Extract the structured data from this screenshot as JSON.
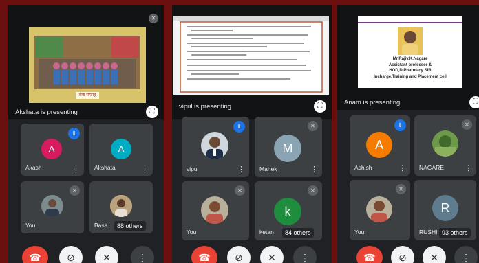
{
  "panels": [
    {
      "presenter_label": "Akshata is presenting",
      "others_label": "88 others",
      "tiles": [
        {
          "name": "Akash",
          "initial": "A",
          "color": "#d81b60"
        },
        {
          "name": "Akshata",
          "initial": "A",
          "color": "#00acc1"
        },
        {
          "name": "You"
        },
        {
          "name": "Basa"
        }
      ],
      "slide_caption": "सेवा सप्ताह"
    },
    {
      "presenter_label": "vipul is presenting",
      "others_label": "84 others",
      "tiles": [
        {
          "name": "vipul"
        },
        {
          "name": "Mahek",
          "initial": "M",
          "color": "#8aa4b4"
        },
        {
          "name": "You"
        },
        {
          "name": "ketan",
          "initial": "k",
          "color": "#1e8e3e"
        }
      ]
    },
    {
      "presenter_label": "Anam is presenting",
      "others_label": "93 others",
      "tiles": [
        {
          "name": "Ashish",
          "initial": "A",
          "color": "#f57c00"
        },
        {
          "name": "NAGARE"
        },
        {
          "name": "You"
        },
        {
          "name": "RUSHI",
          "initial": "R",
          "color": "#5f7c8e"
        }
      ],
      "slide_lines": [
        "Mr.Rajiv.K.Nagare",
        "Assistant professor &",
        "HOD,D.Pharmacy SIR",
        "Incharge,Training and Placement cell"
      ]
    }
  ],
  "icons": {
    "fullscreen": "fullscreen-icon",
    "end_call": "end-call-icon",
    "camera_off": "camera-off-icon",
    "mic_off": "mic-off-icon",
    "more": "more-options-icon",
    "speaking": "speaking-icon"
  },
  "colors": {
    "background": "#6b0e0e",
    "phone": "#1f2124",
    "tile": "#3c4043",
    "end_call": "#ea4335",
    "speaking": "#1a73e8"
  }
}
